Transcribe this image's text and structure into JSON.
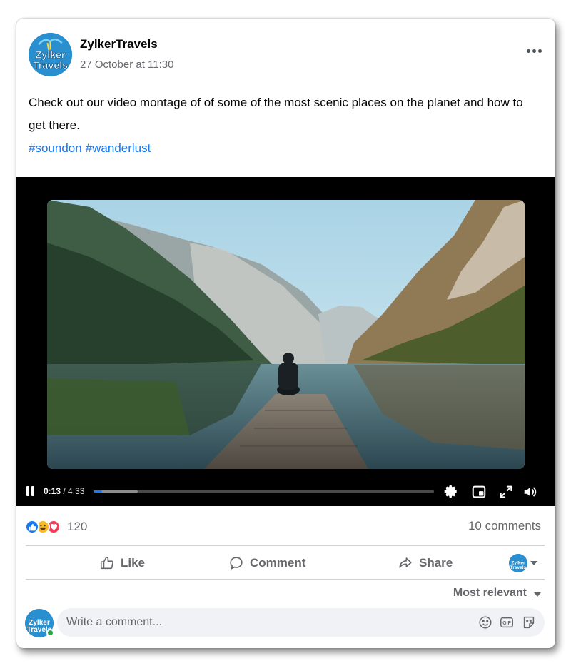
{
  "post": {
    "author": "ZylkerTravels",
    "timestamp": "27 October at 11:30",
    "text": "Check out our video montage of of some of the most scenic places on the planet and how to get there.",
    "hashtags": [
      "#soundon",
      "#wanderlust"
    ],
    "avatar_text_line1": "Zylker",
    "avatar_text_line2": "Travels"
  },
  "video": {
    "current_time": "0:13",
    "duration": "/ 4:33",
    "progress_fraction": 0.025,
    "buffered_fraction": 0.13
  },
  "engagement": {
    "reaction_count": "120",
    "comments_count": "10 comments"
  },
  "actions": {
    "like": "Like",
    "comment": "Comment",
    "share": "Share"
  },
  "comments": {
    "sort_label": "Most relevant",
    "input_placeholder": "Write a comment..."
  },
  "icons": {
    "menu": "more-horizontal-icon",
    "pause": "pause-icon",
    "settings": "gear-icon",
    "pip": "picture-in-picture-icon",
    "fullscreen": "fullscreen-icon",
    "volume": "volume-icon",
    "emoji": "emoji-icon",
    "gif": "gif-icon",
    "sticker": "sticker-icon"
  },
  "colors": {
    "accent": "#1877f2",
    "like": "#1877f2",
    "haha": "#f7b928",
    "love": "#f33e58",
    "online": "#31a24c"
  }
}
